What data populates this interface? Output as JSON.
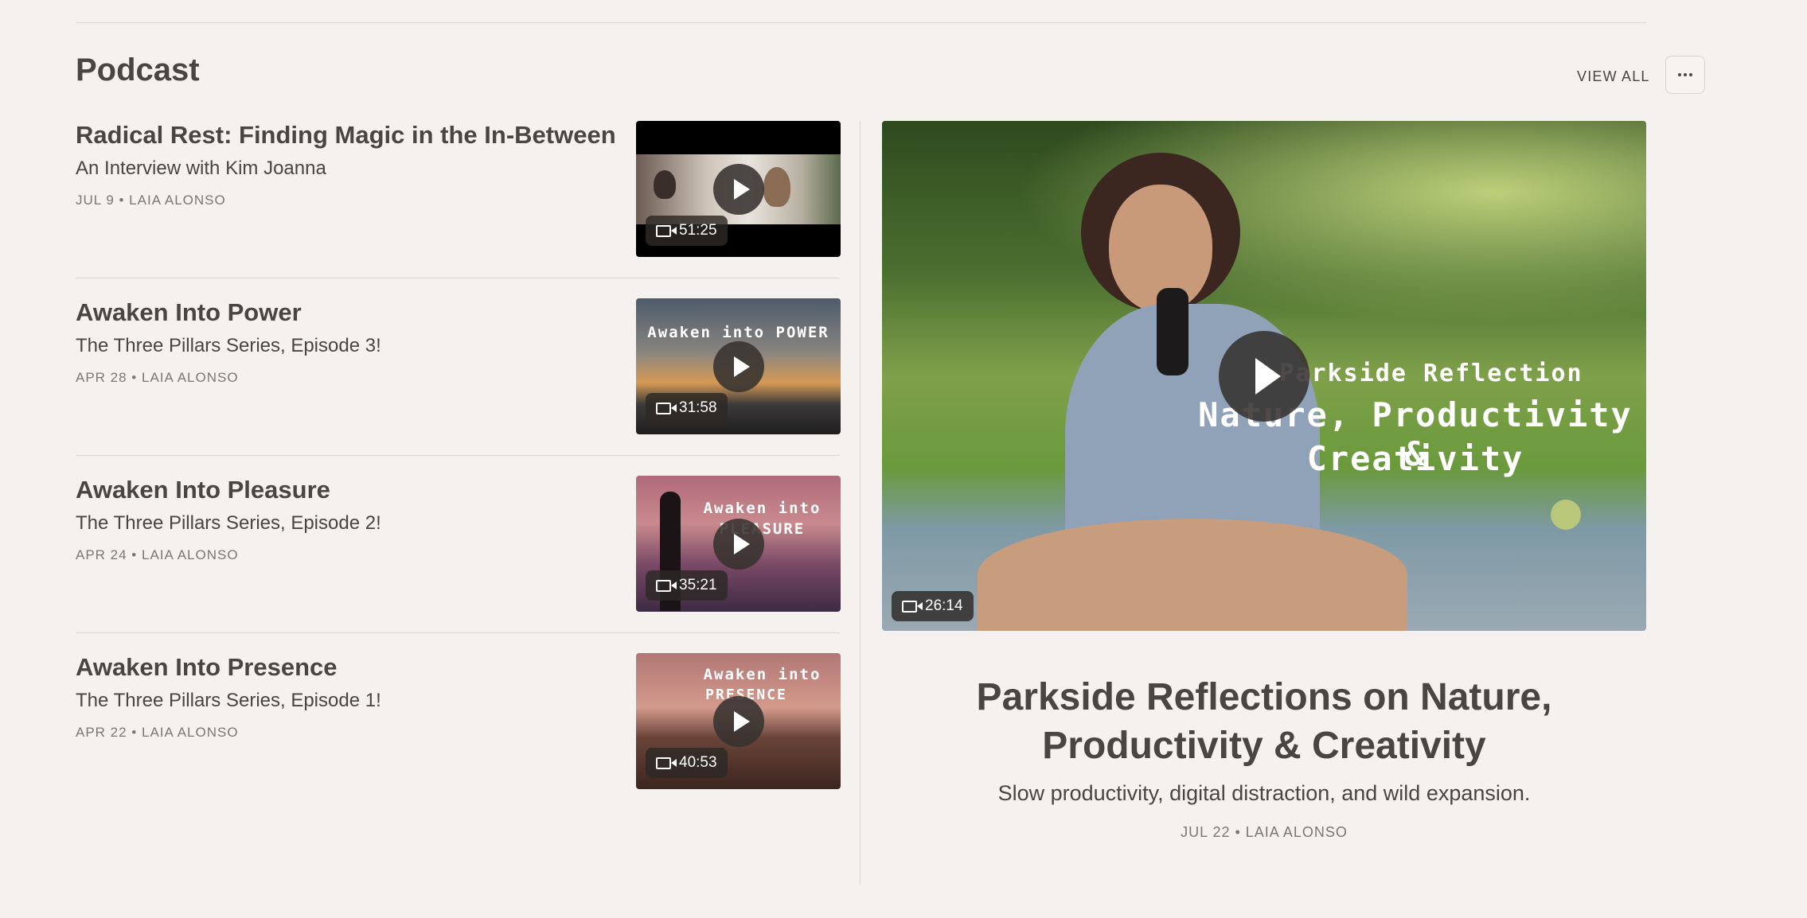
{
  "section": {
    "title": "Podcast",
    "view_all_label": "VIEW ALL",
    "more_icon": "ellipsis-icon"
  },
  "posts": [
    {
      "title": "Radical Rest: Finding Magic in the In-Between",
      "subtitle": "An Interview with Kim Joanna",
      "meta": "JUL 9 • LAIA ALONSO",
      "duration": "51:25",
      "thumb_text": ""
    },
    {
      "title": "Awaken Into Power",
      "subtitle": "The Three Pillars Series, Episode 3!",
      "meta": "APR 28 • LAIA ALONSO",
      "duration": "31:58",
      "thumb_text": "Awaken into POWER"
    },
    {
      "title": "Awaken Into Pleasure",
      "subtitle": "The Three Pillars Series, Episode 2!",
      "meta": "APR 24 • LAIA ALONSO",
      "duration": "35:21",
      "thumb_text": "Awaken into"
    },
    {
      "title": "Awaken Into Presence",
      "subtitle": "The Three Pillars Series, Episode 1!",
      "meta": "APR 22 • LAIA ALONSO",
      "duration": "40:53",
      "thumb_text": "Awaken into"
    }
  ],
  "thumb_sub_texts": [
    "PLEASURE",
    "PRESENCE"
  ],
  "featured": {
    "title": "Parkside Reflections on Nature, Productivity & Creativity",
    "subtitle": "Slow productivity, digital distraction, and wild expansion.",
    "meta": "JUL 22 • LAIA ALONSO",
    "duration": "26:14",
    "overlay_line1": "Parkside Reflection",
    "overlay_line2": "Nature, Productivity &",
    "overlay_line3": "Creativity"
  },
  "colors": {
    "background": "#f5f1ee",
    "text": "#4a4442",
    "meta": "#7d7673",
    "divider": "#dcd6d2"
  }
}
